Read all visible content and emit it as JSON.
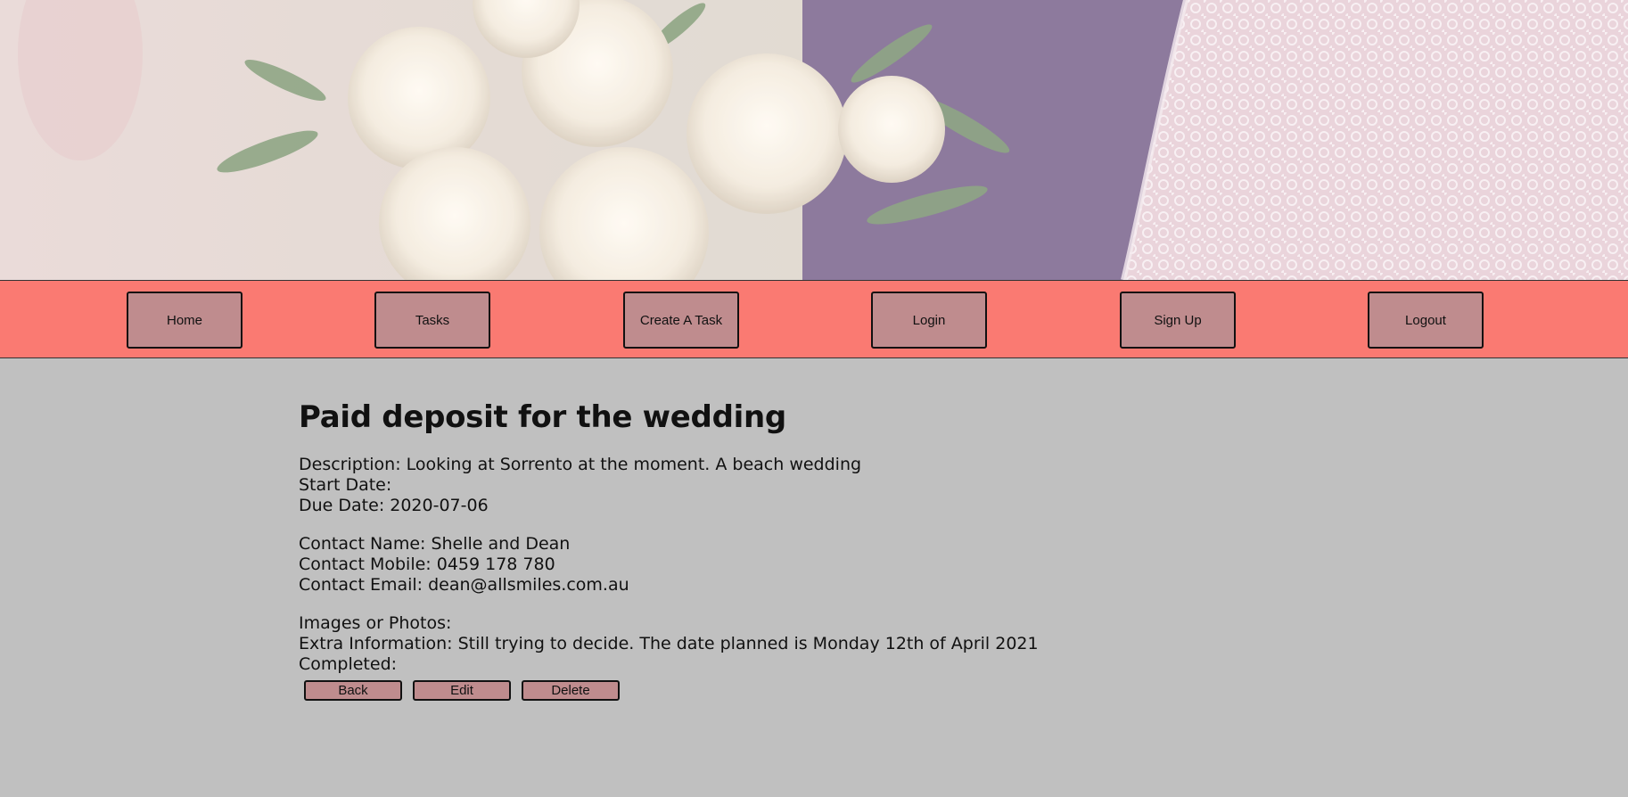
{
  "nav": {
    "items": [
      {
        "label": "Home"
      },
      {
        "label": "Tasks"
      },
      {
        "label": "Create A Task"
      },
      {
        "label": "Login"
      },
      {
        "label": "Sign Up"
      },
      {
        "label": "Logout"
      }
    ]
  },
  "task": {
    "title": "Paid deposit for the wedding",
    "description": "Description: Looking at Sorrento at the moment. A beach wedding",
    "start_date": "Start Date:",
    "due_date": "Due Date: 2020-07-06",
    "contact_name": "Contact Name: Shelle and Dean",
    "contact_mobile": "Contact Mobile: 0459 178 780",
    "contact_email": "Contact Email: dean@allsmiles.com.au",
    "images": "Images or Photos:",
    "extra_info": "Extra Information: Still trying to decide. The date planned is Monday 12th of April 2021",
    "completed": "Completed:"
  },
  "actions": {
    "back_label": "Back",
    "edit_label": "Edit",
    "delete_label": "Delete"
  },
  "colors": {
    "navbar": "#fa7a72",
    "button": "#bf8c8e",
    "page_background": "#c0c0c0"
  }
}
